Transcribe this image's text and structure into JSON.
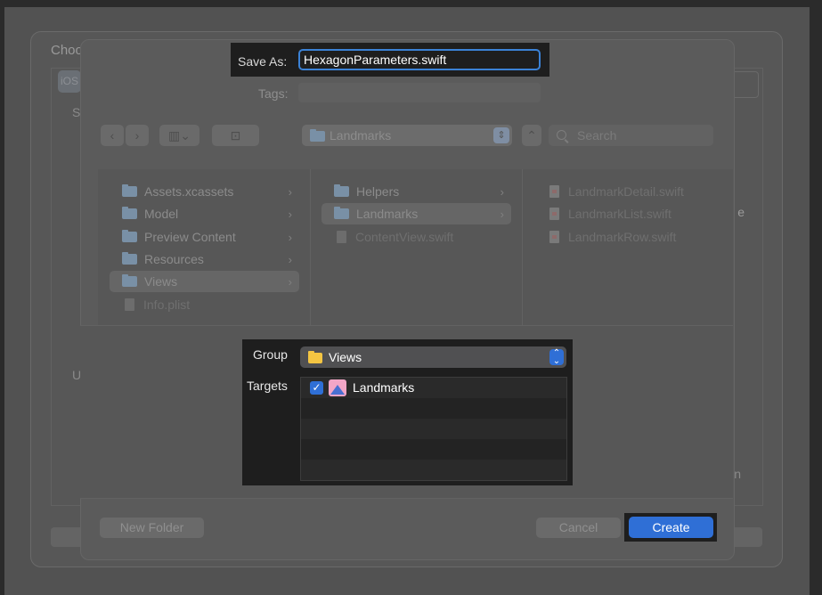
{
  "background": {
    "title_fragment": "Choo",
    "ios_chip": "iOS",
    "s_fragment": "S",
    "u_fragment": "U",
    "e_fragment": "e",
    "n_fragment": "n"
  },
  "dialog": {
    "save_as_label": "Save As:",
    "file_name": "HexagonParameters.swift",
    "tags_label": "Tags:",
    "location": "Landmarks",
    "search_placeholder": "Search"
  },
  "browser": {
    "column1": [
      "Assets.xcassets",
      "Model",
      "Preview Content",
      "Resources",
      "Views",
      "Info.plist"
    ],
    "column2": [
      "Helpers",
      "Landmarks",
      "ContentView.swift"
    ],
    "column3": [
      "LandmarkDetail.swift",
      "LandmarkList.swift",
      "LandmarkRow.swift"
    ]
  },
  "options": {
    "group_label": "Group",
    "group_value": "Views",
    "targets_label": "Targets",
    "target_name": "Landmarks"
  },
  "buttons": {
    "new_folder": "New Folder",
    "cancel": "Cancel",
    "create": "Create"
  },
  "icons": [
    "folder-icon",
    "file-icon",
    "search-icon",
    "checkbox-icon",
    "app-icon",
    "chevron-right-icon"
  ],
  "colors": {
    "accent": "#2f6fd6",
    "focus_ring": "#3b82d6",
    "group_folder": "#f4c542"
  }
}
